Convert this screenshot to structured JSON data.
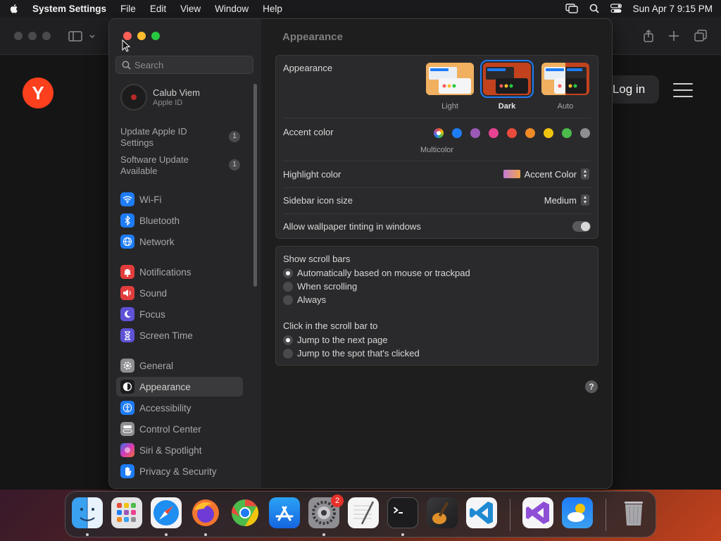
{
  "menubar": {
    "app": "System Settings",
    "items": [
      "File",
      "Edit",
      "View",
      "Window",
      "Help"
    ],
    "datetime": "Sun Apr 7  9:15 PM"
  },
  "browser": {
    "logo": "Y",
    "login": "Log in"
  },
  "sidebar": {
    "search_placeholder": "Search",
    "user": {
      "name": "Calub Viem",
      "sub": "Apple ID"
    },
    "updates": [
      {
        "label": "Update Apple ID Settings",
        "count": "1"
      },
      {
        "label": "Software Update Available",
        "count": "1"
      }
    ],
    "items": [
      {
        "label": "Wi-Fi",
        "icon": "wifi-icon",
        "color": "#1e7cf6"
      },
      {
        "label": "Bluetooth",
        "icon": "bluetooth-icon",
        "color": "#1e7cf6"
      },
      {
        "label": "Network",
        "icon": "globe-icon",
        "color": "#1e7cf6"
      },
      {
        "label": "Notifications",
        "icon": "bell-icon",
        "color": "#e23d3d"
      },
      {
        "label": "Sound",
        "icon": "speaker-icon",
        "color": "#e23d3d"
      },
      {
        "label": "Focus",
        "icon": "moon-icon",
        "color": "#5e52d6"
      },
      {
        "label": "Screen Time",
        "icon": "hourglass-icon",
        "color": "#5e52d6"
      },
      {
        "label": "General",
        "icon": "gear-icon",
        "color": "#8e8e93"
      },
      {
        "label": "Appearance",
        "icon": "appearance-icon",
        "color": "#1c1c1e"
      },
      {
        "label": "Accessibility",
        "icon": "accessibility-icon",
        "color": "#1e7cf6"
      },
      {
        "label": "Control Center",
        "icon": "control-center-icon",
        "color": "#8e8e93"
      },
      {
        "label": "Siri & Spotlight",
        "icon": "siri-icon",
        "color": "#b23ad6"
      },
      {
        "label": "Privacy & Security",
        "icon": "hand-icon",
        "color": "#1e7cf6"
      }
    ],
    "selected": "Appearance"
  },
  "main": {
    "title": "Appearance",
    "appearance": {
      "label": "Appearance",
      "options": [
        "Light",
        "Dark",
        "Auto"
      ],
      "selected": "Dark"
    },
    "accent": {
      "label": "Accent color",
      "multicolor_label": "Multicolor",
      "colors": [
        "#ffffff",
        "#1e7cf6",
        "#9b59b6",
        "#e84393",
        "#e74c3c",
        "#f08a24",
        "#f1c40f",
        "#4cbb4c",
        "#8e8e93"
      ]
    },
    "highlight": {
      "label": "Highlight color",
      "value": "Accent Color"
    },
    "sidebar_icon": {
      "label": "Sidebar icon size",
      "value": "Medium"
    },
    "tinting": {
      "label": "Allow wallpaper tinting in windows",
      "on": true
    },
    "scrollbars": {
      "label": "Show scroll bars",
      "options": [
        "Automatically based on mouse or trackpad",
        "When scrolling",
        "Always"
      ],
      "selected": 0
    },
    "click_scroll": {
      "label": "Click in the scroll bar to",
      "options": [
        "Jump to the next page",
        "Jump to the spot that's clicked"
      ],
      "selected": 0
    },
    "help": "?"
  },
  "dock": {
    "apps": [
      "Finder",
      "Launchpad",
      "Safari",
      "Firefox",
      "Chrome",
      "App Store",
      "System Settings",
      "TextEdit",
      "Terminal",
      "GarageBand",
      "Visual Studio Code",
      "Visual Studio",
      "Weather",
      "Trash"
    ],
    "settings_badge": "2"
  }
}
